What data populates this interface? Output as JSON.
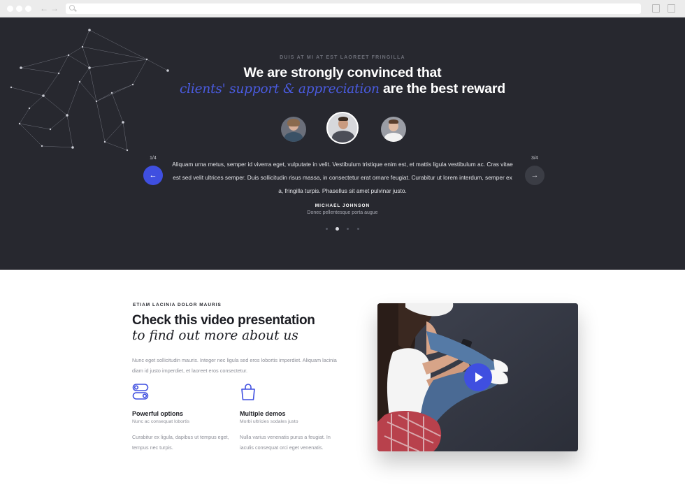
{
  "testimonials": {
    "eyebrow": "Duis at mi at est laoreet fringilla",
    "heading_line1": "We are strongly convinced that",
    "heading_accent": "clients' support & appreciation",
    "heading_rest": " are the best reward",
    "counter_prev": "1/4",
    "counter_next": "3/4",
    "prev_icon": "←",
    "next_icon": "→",
    "quote": "Aliquam urna metus, semper id viverra eget, vulputate in velit. Vestibulum tristique enim est, et mattis ligula vestibulum ac. Cras vitae est sed velit ultrices semper. Duis sollicitudin risus massa, in consectetur erat ornare feugiat. Curabitur ut lorem interdum, semper ex a, fringilla turpis. Phasellus sit amet pulvinar justo.",
    "author_name": "Michael Johnson",
    "author_role": "Donec pellentesque porta augue",
    "active_dot": 2,
    "dot_count": 4,
    "accent_color": "#3f4fe0"
  },
  "video_section": {
    "eyebrow": "Etiam lacinia dolor mauris",
    "heading_line1": "Check this video presentation",
    "heading_line2": "to find out more about us",
    "body": "Nunc eget sollicitudin mauris. Integer nec ligula sed eros lobortis imperdiet. Aliquam lacinia diam id justo imperdiet, et laoreet eros consectetur.",
    "features": [
      {
        "icon": "toggle-icon",
        "title": "Powerful options",
        "subtitle": "Nunc ac consequat lobortis",
        "body": "Curabitur ex ligula, dapibus ut tempus eget, tempus nec turpis."
      },
      {
        "icon": "shopping-bag-icon",
        "title": "Multiple demos",
        "subtitle": "Morbi ultricies sodales justo",
        "body": "Nulla varius venenatis purus a feugiat. In iaculis consequat orci eget venenatis."
      }
    ],
    "play_icon": "play-icon"
  }
}
